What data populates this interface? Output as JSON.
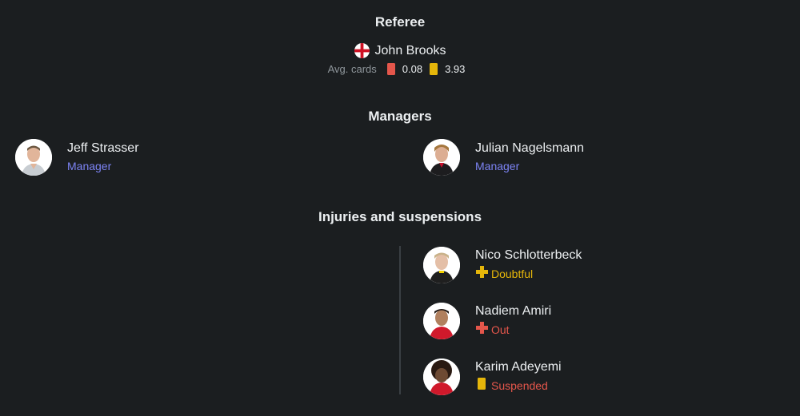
{
  "referee": {
    "title": "Referee",
    "flag_icon": "england-flag-icon",
    "name": "John Brooks",
    "avg_cards_label": "Avg. cards",
    "red_cards": "0.08",
    "yellow_cards": "3.93"
  },
  "managers": {
    "title": "Managers",
    "home": {
      "name": "Jeff Strasser",
      "role": "Manager"
    },
    "away": {
      "name": "Julian Nagelsmann",
      "role": "Manager"
    }
  },
  "injuries": {
    "title": "Injuries and suspensions",
    "players": [
      {
        "name": "Nico Schlotterbeck",
        "status": "Doubtful",
        "status_icon": "plus-icon",
        "status_color": "#e5b60a"
      },
      {
        "name": "Nadiem Amiri",
        "status": "Out",
        "status_icon": "plus-icon",
        "status_color": "#e4564b"
      },
      {
        "name": "Karim Adeyemi",
        "status": "Suspended",
        "status_icon": "yellow-card-icon",
        "status_color": "#e4564b"
      }
    ]
  },
  "colors": {
    "background": "#1b1e20",
    "manager_role": "#7c83f3",
    "red_card": "#e4564b",
    "yellow_card": "#e5b60a"
  }
}
